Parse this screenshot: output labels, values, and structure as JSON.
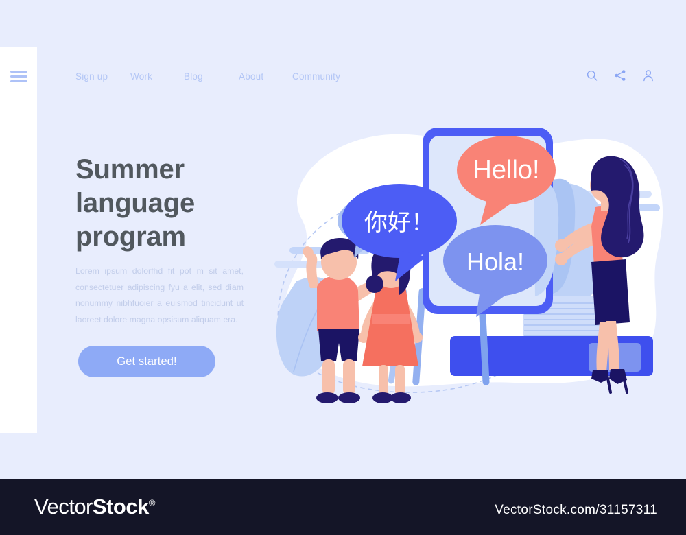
{
  "page": {
    "background_color": "#e8edfd",
    "sidebar_color": "#ffffff"
  },
  "sidebar": {
    "menu_icon": "hamburger-icon"
  },
  "nav": {
    "links": [
      {
        "label": "Sign up"
      },
      {
        "label": "Work"
      },
      {
        "label": "Blog"
      },
      {
        "label": "About"
      },
      {
        "label": "Community"
      }
    ],
    "icons": [
      {
        "name": "search-icon"
      },
      {
        "name": "share-icon"
      },
      {
        "name": "user-account-icon"
      }
    ],
    "link_color": "#b3c6f6",
    "icon_color": "#8ba6f4"
  },
  "hero": {
    "headline": "Summer language program",
    "headline_color": "#51585e",
    "body": "Lorem ipsum dolorfhd fit pot m sit amet, consectetuer adipiscing fyu  a elit, sed diam nonummy nibhfuoier a euismod tincidunt ut laoreet dolore magna opsisum aliquam era.",
    "body_color": "#c2cdea",
    "cta_label": "Get started!",
    "cta_color": "#8eaaf6",
    "cta_text_color": "#ffffff"
  },
  "illustration": {
    "name": "summer-language-program-illustration",
    "blob_color": "#ffffff",
    "speech_bubbles": [
      {
        "name": "hello-bubble",
        "text": "Hello!",
        "color": "#f98376",
        "text_color": "#ffffff"
      },
      {
        "name": "nihao-bubble",
        "text": "你好！",
        "color": "#4c5df5",
        "text_color": "#ffffff"
      },
      {
        "name": "hola-bubble",
        "text": "Hola!",
        "color": "#7d93ef",
        "text_color": "#ffffff"
      }
    ],
    "figures": [
      {
        "name": "boy-student",
        "shirt_color": "#f98376",
        "shorts_color": "#1b1464",
        "hair_color": "#241a6e"
      },
      {
        "name": "girl-student",
        "dress_color": "#f5705f",
        "hair_color": "#241a6e"
      },
      {
        "name": "teacher-woman",
        "top_color": "#f98376",
        "skirt_color": "#1b1464",
        "hair_color": "#241a6e"
      }
    ],
    "objects": [
      {
        "name": "whiteboard-easel",
        "color": "#4c5df5"
      },
      {
        "name": "book-stack",
        "color": "#3e4fee"
      },
      {
        "name": "mini-chat-bubble",
        "color": "#a8c0f2"
      },
      {
        "name": "dotted-arc",
        "color": "#b6c8f3"
      }
    ]
  },
  "watermark": {
    "logo_first": "Vector",
    "logo_second": "Stock",
    "registered": "®",
    "url": "VectorStock.com/31157311",
    "bar_color": "#141527"
  }
}
